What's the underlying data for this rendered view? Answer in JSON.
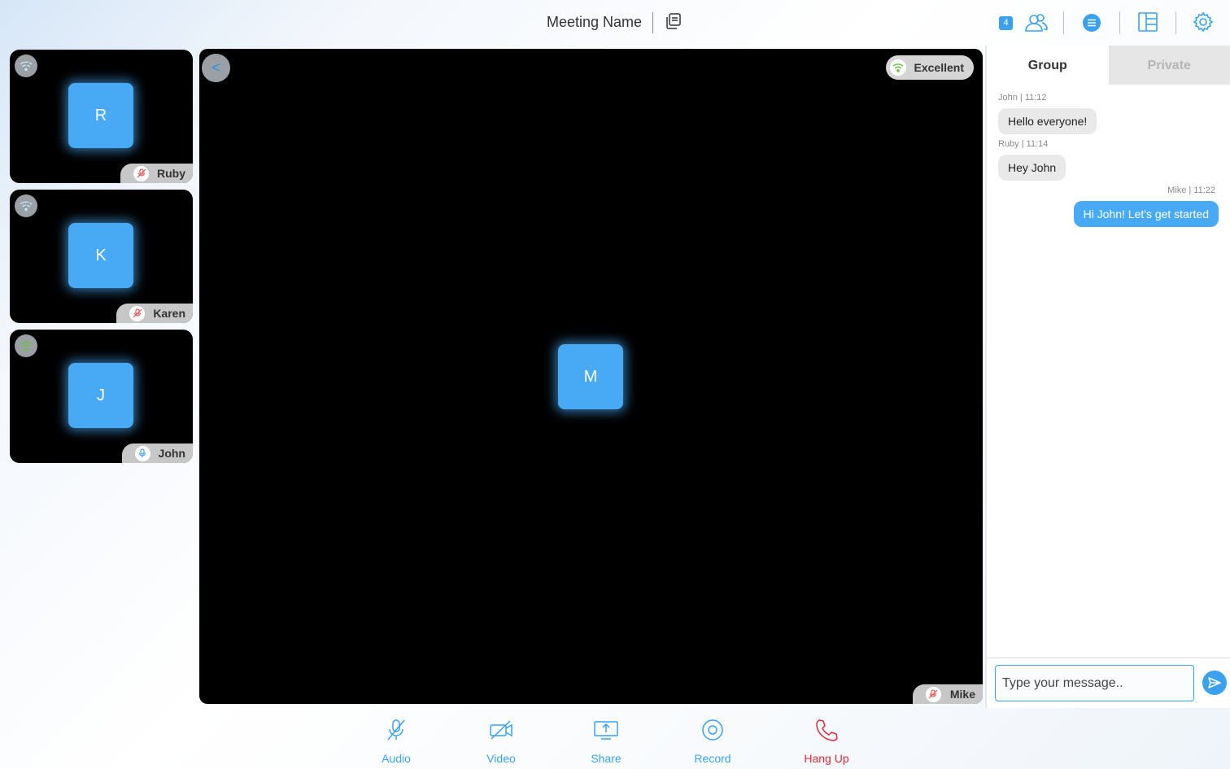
{
  "header": {
    "meeting_name": "Meeting Name",
    "participant_count": "4"
  },
  "participants": [
    {
      "initial": "R",
      "name": "Ruby",
      "network": "poor",
      "mic": "muted"
    },
    {
      "initial": "K",
      "name": "Karen",
      "network": "poor",
      "mic": "muted"
    },
    {
      "initial": "J",
      "name": "John",
      "network": "good",
      "mic": "on"
    }
  ],
  "main_video": {
    "initial": "M",
    "name": "Mike",
    "quality_label": "Excellent",
    "back_label": "<"
  },
  "chat": {
    "tabs": [
      {
        "label": "Group",
        "active": true
      },
      {
        "label": "Private",
        "active": false
      }
    ],
    "messages": [
      {
        "meta": "John | 11:12",
        "text": "Hello everyone!",
        "mine": false
      },
      {
        "meta": "Ruby | 11:14",
        "text": "Hey John",
        "mine": false
      },
      {
        "meta": "Mike | 11:22",
        "text": "Hi John! Let's get started",
        "mine": true
      }
    ],
    "input_placeholder": "Type your message.."
  },
  "controls": {
    "audio": "Audio",
    "video": "Video",
    "share": "Share",
    "record": "Record",
    "hangup": "Hang Up"
  },
  "colors": {
    "accent": "#3ba1ee",
    "avatar": "#48a9f5",
    "danger": "#e0283c"
  }
}
